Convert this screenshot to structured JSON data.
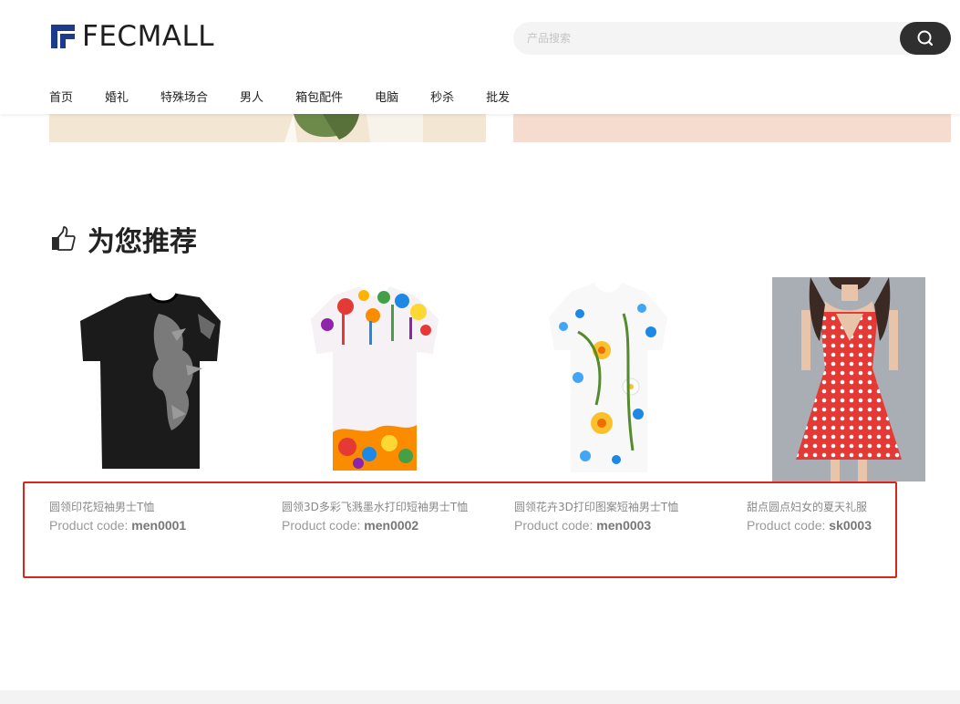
{
  "header": {
    "logo_text": "FECMALL",
    "search_placeholder": "产品搜索",
    "nav": [
      "首页",
      "婚礼",
      "特殊场合",
      "男人",
      "箱包配件",
      "电脑",
      "秒杀",
      "批发"
    ]
  },
  "section": {
    "title": "为您推荐"
  },
  "products": [
    {
      "name": "圆领印花短袖男士T恤",
      "code_label": "Product code:",
      "code": "men0001"
    },
    {
      "name": "圆领3D多彩飞溅墨水打印短袖男士T恤",
      "code_label": "Product code:",
      "code": "men0002"
    },
    {
      "name": "圆领花卉3D打印图案短袖男士T恤",
      "code_label": "Product code:",
      "code": "men0003"
    },
    {
      "name": "甜点圆点妇女的夏天礼服",
      "code_label": "Product code:",
      "code": "sk0003"
    }
  ],
  "colors": {
    "accent_dark": "#2f2f2f",
    "highlight_box": "#d9261c",
    "logo_blue": "#1e3a8a"
  }
}
